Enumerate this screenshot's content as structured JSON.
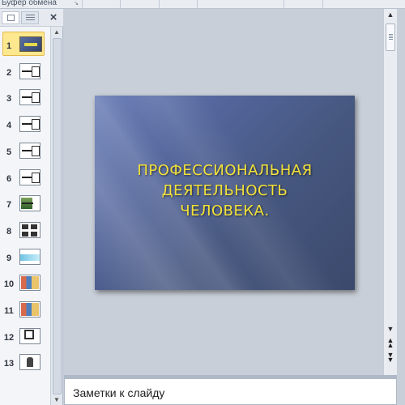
{
  "ribbon": {
    "group_label": "Буфер обмена"
  },
  "panel": {
    "tabs": [
      {
        "name": "slides",
        "active": true
      },
      {
        "name": "outline",
        "active": false
      }
    ],
    "close_glyph": "×",
    "thumbnails": [
      {
        "num": "1",
        "kind": "title-dark",
        "selected": true
      },
      {
        "num": "2",
        "kind": "white-with-box"
      },
      {
        "num": "3",
        "kind": "white-with-box"
      },
      {
        "num": "4",
        "kind": "white-with-box"
      },
      {
        "num": "5",
        "kind": "white-with-box"
      },
      {
        "num": "6",
        "kind": "white-with-box"
      },
      {
        "num": "7",
        "kind": "photo"
      },
      {
        "num": "8",
        "kind": "grid"
      },
      {
        "num": "9",
        "kind": "cyan"
      },
      {
        "num": "10",
        "kind": "collage"
      },
      {
        "num": "11",
        "kind": "collage"
      },
      {
        "num": "12",
        "kind": "big-square"
      },
      {
        "num": "13",
        "kind": "figure"
      }
    ]
  },
  "slide": {
    "title_lines": [
      "ПРОФЕССИОНАЛЬНАЯ",
      "ДЕЯТЕЛЬНОСТЬ",
      "ЧЕЛОВЕКА."
    ],
    "title_color": "#f3e23a"
  },
  "notes": {
    "placeholder": "Заметки к слайду"
  },
  "scroll": {
    "up_glyph": "▲",
    "down_glyph": "▼",
    "prev_glyph": "⯭",
    "next_glyph": "⯯"
  }
}
